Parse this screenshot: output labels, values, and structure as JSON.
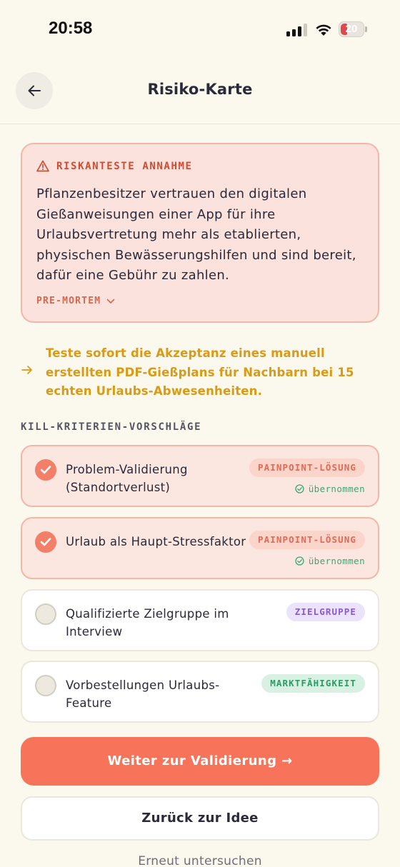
{
  "status_bar": {
    "time": "20:58",
    "battery": "20"
  },
  "header": {
    "title": "Risiko-Karte"
  },
  "risk_card": {
    "label": "RISKANTESTE ANNAHME",
    "text": "Pflanzenbesitzer vertrauen den digitalen Gießanweisungen einer App für ihre Urlaubsvertretung mehr als etablierten, physischen Bewässerungshilfen und sind bereit, dafür eine Gebühr zu zahlen.",
    "premortem_label": "PRE-MORTEM"
  },
  "suggestion": {
    "text": "Teste sofort die Akzeptanz eines manuell erstellten PDF-Gießplans für Nachbarn bei 15 echten Urlaubs-Abwesenheiten."
  },
  "criteria_section": {
    "label": "KILL-KRITERIEN-VORSCHLÄGE",
    "items": [
      {
        "label": "Problem-Validierung (Standortverlust)",
        "tag": "PAINPOINT-LÖSUNG",
        "selected": true,
        "status": "übernommen"
      },
      {
        "label": "Urlaub als Haupt-Stressfaktor",
        "tag": "PAINPOINT-LÖSUNG",
        "selected": true,
        "status": "übernommen"
      },
      {
        "label": "Qualifizierte Zielgruppe im Interview",
        "tag": "ZIELGRUPPE",
        "selected": false
      },
      {
        "label": "Vorbestellungen Urlaubs-Feature",
        "tag": "MARKTFÄHIGKEIT",
        "selected": false
      }
    ]
  },
  "actions": {
    "primary": "Weiter zur Validierung →",
    "secondary": "Zurück zur Idee",
    "tertiary": "Erneut untersuchen"
  },
  "colors": {
    "background": "#fbf8ee",
    "accent": "#f7735a",
    "risk_text": "#cf4c33",
    "suggestion": "#d99a16",
    "accepted": "#3aa877"
  }
}
